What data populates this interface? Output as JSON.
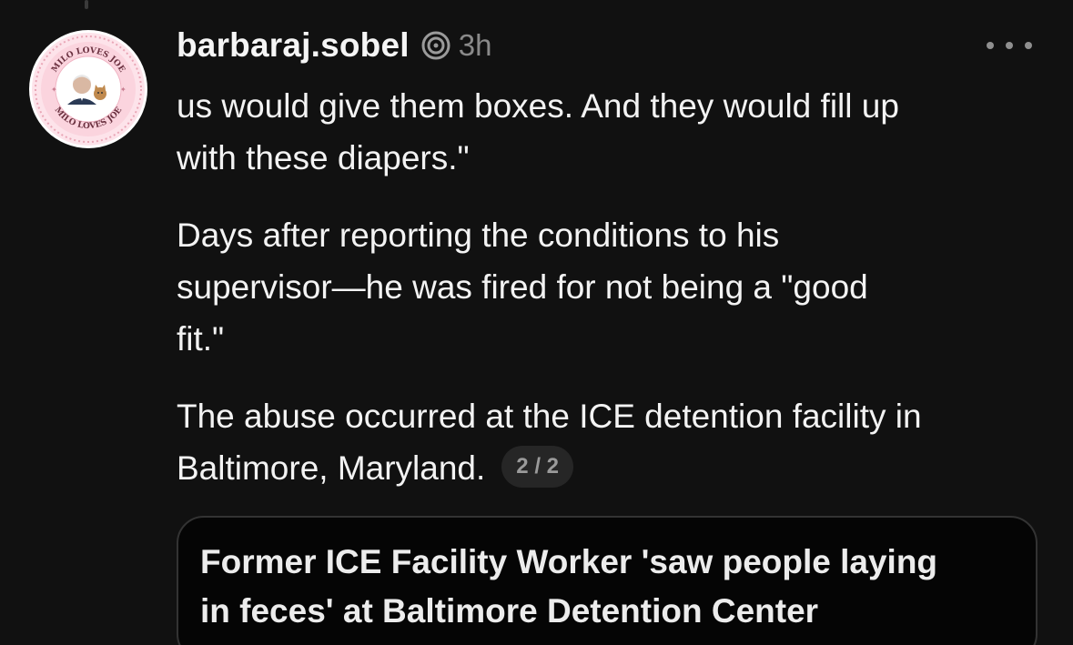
{
  "post": {
    "username": "barbaraj.sobel",
    "time": "3h",
    "paragraphs": [
      "us would give them boxes. And they would fill up\nwith these diapers.\"",
      "Days after reporting the conditions to his\nsupervisor—he was fired for not being a \"good\nfit.\"",
      "The abuse occurred at the ICE detention facility in\nBaltimore, Maryland."
    ],
    "page_indicator": "2 / 2"
  },
  "avatar": {
    "text_top": "MILO LOVES JOE",
    "text_bottom": "MILO LOVES JOE",
    "ring_color": "#f4c6d0",
    "border_color": "#e9a6b6"
  },
  "link_card": {
    "title": "Former ICE Facility Worker 'saw people laying\nin feces' at Baltimore Detention Center"
  },
  "icons": {
    "verified": "threads-logo-icon",
    "more": "more-options-icon"
  }
}
